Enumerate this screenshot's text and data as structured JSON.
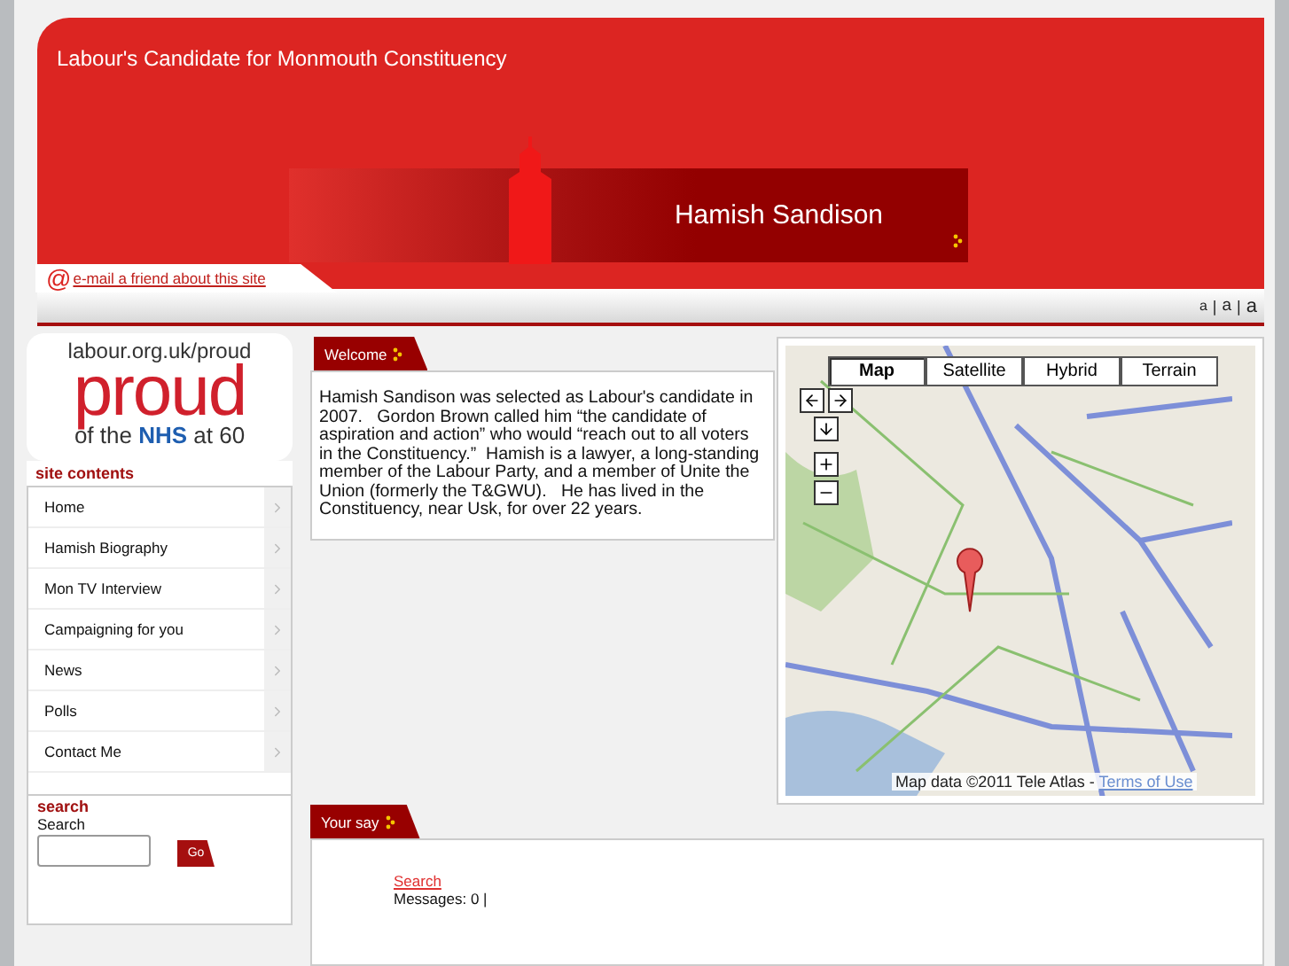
{
  "header": {
    "tagline": "Labour's Candidate for Monmouth Constituency",
    "name": "Hamish Sandison",
    "email_icon": "@",
    "email_link": "e-mail a friend about this site",
    "text_sizes": [
      "a",
      "a",
      "a"
    ],
    "size_separators": [
      "|",
      "|"
    ]
  },
  "sidebar": {
    "logo": {
      "url": "labour.org.uk/proud",
      "word": "proud",
      "line_start": "of the ",
      "line_bold": "NHS",
      "line_end": " at 60"
    },
    "heading": "site contents",
    "items": [
      {
        "label": "Home"
      },
      {
        "label": "Hamish Biography"
      },
      {
        "label": "Mon TV Interview"
      },
      {
        "label": "Campaigning for you"
      },
      {
        "label": "News"
      },
      {
        "label": "Polls"
      },
      {
        "label": "Contact Me"
      }
    ],
    "search": {
      "heading": "search",
      "label": "Search",
      "button": "Go"
    }
  },
  "welcome": {
    "tab": "Welcome",
    "text": "Hamish Sandison was selected as Labour's candidate in 2007.   Gordon Brown called him “the candidate of aspiration and action” who would “reach out to all voters in the Constituency.”  Hamish is a lawyer, a long-standing member of the Labour Party, and a member of Unite the Union (formerly the T&GWU).   He has lived in the Constituency, near Usk, for over 22 years."
  },
  "map": {
    "types": [
      {
        "label": "Map",
        "selected": true
      },
      {
        "label": "Satellite",
        "selected": false
      },
      {
        "label": "Hybrid",
        "selected": false
      },
      {
        "label": "Terrain",
        "selected": false
      }
    ],
    "attribution": "Map data ©2011 Tele Atlas - ",
    "terms": "Terms of Use"
  },
  "your_say": {
    "tab": "Your say",
    "link": "Search",
    "messages": "Messages: 0 |"
  }
}
